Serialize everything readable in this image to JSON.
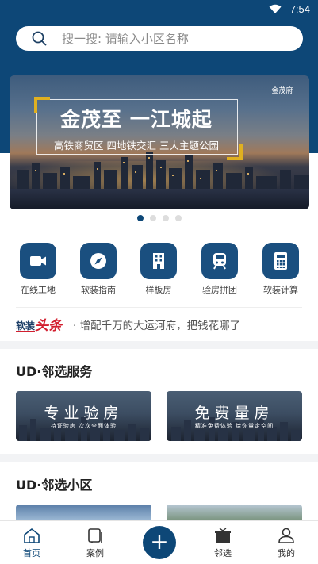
{
  "status_bar": {
    "time": "7:54"
  },
  "search": {
    "placeholder": "搜一搜: 请输入小区名称"
  },
  "banner": {
    "title": "金茂至 一江城起",
    "subtitle": "高铁商贸区 四地铁交汇 三大主题公园",
    "logo_text": "金茂府"
  },
  "carousel": {
    "count": 4,
    "active": 0
  },
  "quick_icons": [
    {
      "label": "在线工地",
      "icon": "video-camera-icon"
    },
    {
      "label": "软装指南",
      "icon": "compass-icon"
    },
    {
      "label": "样板房",
      "icon": "building-icon"
    },
    {
      "label": "验房拼团",
      "icon": "train-icon"
    },
    {
      "label": "软装计算",
      "icon": "calculator-icon"
    }
  ],
  "news": {
    "tag_small": "软装",
    "tag_big": "头条",
    "headline": "· 增配千万的大运河府，把钱花哪了"
  },
  "services": {
    "title": "UD·邻选服务",
    "cards": [
      {
        "title": "专业验房",
        "subtitle": "持证验房  次次全面体验"
      },
      {
        "title": "免费量房",
        "subtitle": "精准免费体验  给你量定空间"
      }
    ]
  },
  "communities": {
    "title": "UD·邻选小区"
  },
  "tabbar": {
    "items": [
      {
        "label": "首页",
        "icon": "home-icon"
      },
      {
        "label": "案例",
        "icon": "cases-icon"
      },
      {
        "label": "",
        "icon": "plus-icon"
      },
      {
        "label": "邻选",
        "icon": "gift-icon"
      },
      {
        "label": "我的",
        "icon": "user-icon"
      }
    ],
    "active": 0
  },
  "colors": {
    "brand": "#0d4777",
    "accent_red": "#d21f2f",
    "gold": "#e0b020"
  }
}
